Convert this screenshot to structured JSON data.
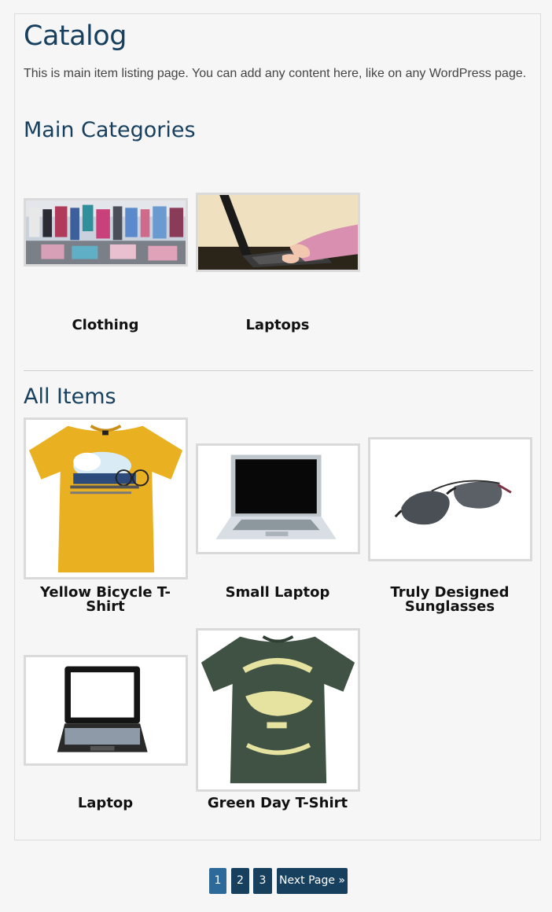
{
  "page": {
    "title": "Catalog",
    "intro": "This is main item listing page. You can add any content here, like on any WordPress page."
  },
  "main_categories": {
    "heading": "Main Categories",
    "items": [
      {
        "name": "Clothing",
        "image": "clothing-store-photo"
      },
      {
        "name": "Laptops",
        "image": "typing-on-laptop-photo"
      }
    ]
  },
  "all_items": {
    "heading": "All Items",
    "items": [
      {
        "name": "Yellow Bicycle T-Shirt",
        "image": "yellow-tshirt-photo"
      },
      {
        "name": "Small Laptop",
        "image": "small-laptop-photo"
      },
      {
        "name_lines": [
          "Truly Designed",
          "Sunglasses"
        ],
        "image": "sunglasses-photo"
      },
      {
        "name": "Laptop",
        "image": "laptop-photo"
      },
      {
        "name": "Green Day T-Shirt",
        "image": "green-tshirt-photo"
      }
    ]
  },
  "pagination": {
    "pages": [
      "1",
      "2",
      "3"
    ],
    "current": "1",
    "next_label": "Next Page »"
  },
  "colors": {
    "heading": "#17405f",
    "pager_bg": "#17405f",
    "pager_current": "#2d6a9a",
    "background": "#f6f6f6"
  }
}
